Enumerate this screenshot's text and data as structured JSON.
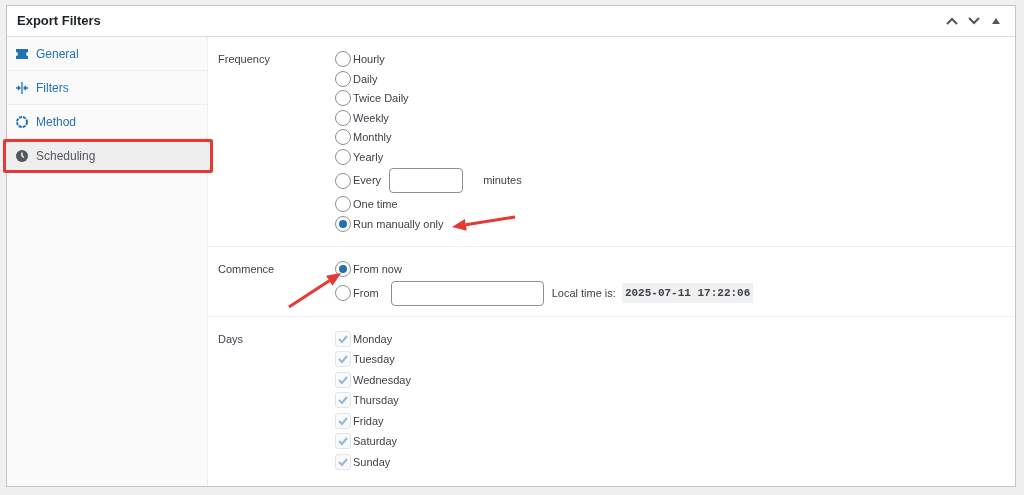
{
  "panel": {
    "title": "Export Filters"
  },
  "sidebar": {
    "items": [
      {
        "label": "General",
        "selected": false,
        "highlighted": false
      },
      {
        "label": "Filters",
        "selected": false,
        "highlighted": false
      },
      {
        "label": "Method",
        "selected": false,
        "highlighted": false
      },
      {
        "label": "Scheduling",
        "selected": true,
        "highlighted": true
      }
    ]
  },
  "frequency": {
    "label": "Frequency",
    "options": [
      {
        "label": "Hourly",
        "selected": false
      },
      {
        "label": "Daily",
        "selected": false
      },
      {
        "label": "Twice Daily",
        "selected": false
      },
      {
        "label": "Weekly",
        "selected": false
      },
      {
        "label": "Monthly",
        "selected": false
      },
      {
        "label": "Yearly",
        "selected": false
      },
      {
        "label": "Every",
        "kind": "input",
        "suffix": "minutes",
        "selected": false
      },
      {
        "label": "One time",
        "selected": false
      },
      {
        "label": "Run manually only",
        "selected": true,
        "annotated": true
      }
    ]
  },
  "commence": {
    "label": "Commence",
    "options": [
      {
        "label": "From now",
        "selected": true,
        "annotated": true
      },
      {
        "label": "From",
        "kind": "input",
        "selected": false
      }
    ],
    "local_time_label": "Local time is:",
    "local_time": "2025-07-11 17:22:06"
  },
  "days": {
    "label": "Days",
    "items": [
      {
        "label": "Monday",
        "checked": true,
        "disabled": true
      },
      {
        "label": "Tuesday",
        "checked": true,
        "disabled": true
      },
      {
        "label": "Wednesday",
        "checked": true,
        "disabled": true
      },
      {
        "label": "Thursday",
        "checked": true,
        "disabled": true
      },
      {
        "label": "Friday",
        "checked": true,
        "disabled": true
      },
      {
        "label": "Saturday",
        "checked": true,
        "disabled": true
      },
      {
        "label": "Sunday",
        "checked": true,
        "disabled": true
      }
    ]
  }
}
